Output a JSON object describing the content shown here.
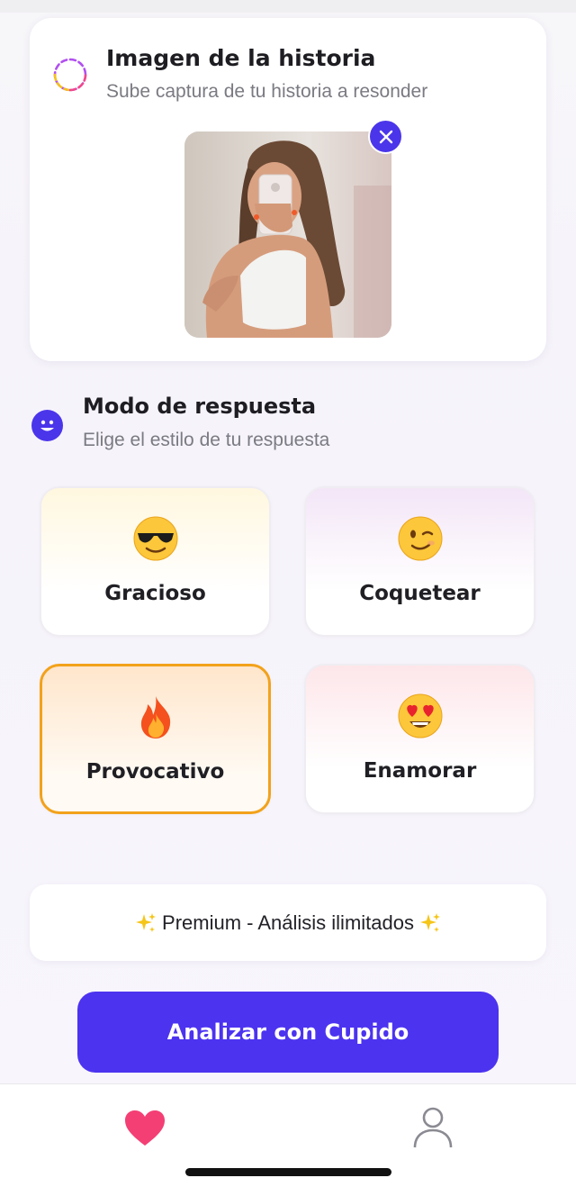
{
  "story": {
    "title": "Imagen de la historia",
    "subtitle": "Sube captura de tu historia a resonder",
    "icon": "story-ring-icon",
    "remove_icon": "close-icon"
  },
  "mode": {
    "title": "Modo de respuesta",
    "subtitle": "Elige el estilo de tu respuesta",
    "icon": "smiley-icon",
    "options": [
      {
        "label": "Gracioso",
        "icon": "sunglasses-emoji",
        "selected": false
      },
      {
        "label": "Coquetear",
        "icon": "wink-emoji",
        "selected": false
      },
      {
        "label": "Provocativo",
        "icon": "fire-emoji",
        "selected": true
      },
      {
        "label": "Enamorar",
        "icon": "heart-eyes-emoji",
        "selected": false
      }
    ]
  },
  "premium": {
    "label": "Premium - Análisis ilimitados",
    "icon": "sparkles-icon"
  },
  "actions": {
    "analyze_label": "Analizar con Cupido"
  },
  "nav": {
    "items": [
      {
        "icon": "heart-icon",
        "active": true
      },
      {
        "icon": "profile-icon",
        "active": false
      }
    ]
  },
  "colors": {
    "accent": "#4c33f0",
    "selected_border": "#f2a21b",
    "heart": "#f43f74"
  }
}
